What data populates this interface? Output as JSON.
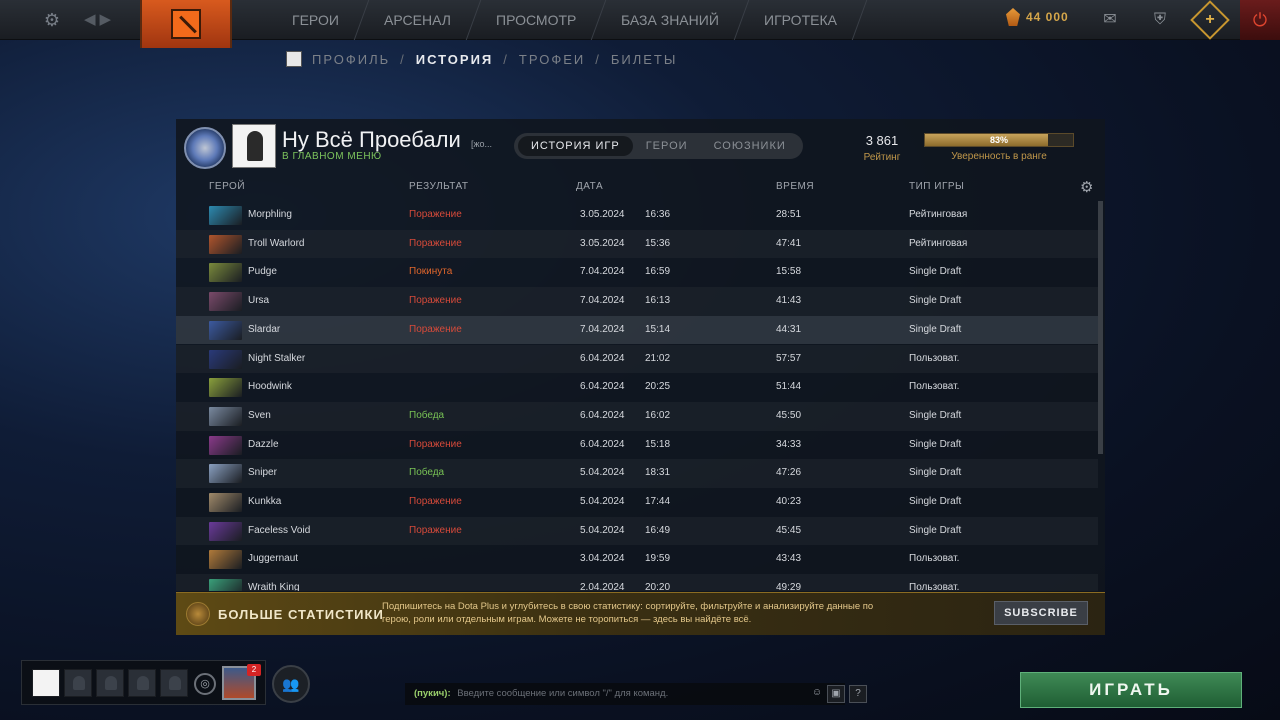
{
  "topbar": {
    "menu": [
      "ГЕРОИ",
      "АРСЕНАЛ",
      "ПРОСМОТР",
      "БАЗА ЗНАНИЙ",
      "ИГРОТЕКА"
    ],
    "currency": "44 000"
  },
  "breadcrumb": {
    "items": [
      "ПРОФИЛЬ",
      "ИСТОРИЯ",
      "ТРОФЕИ",
      "БИЛЕТЫ"
    ],
    "separator": "/",
    "active": "ИСТОРИЯ"
  },
  "profile": {
    "name": "Ну Всё Проебали",
    "tag": "[жо...",
    "status": "В ГЛАВНОМ МЕНЮ",
    "tabs": [
      "ИСТОРИЯ ИГР",
      "ГЕРОИ",
      "СОЮЗНИКИ"
    ],
    "rating_value": "3 861",
    "rating_label": "Рейтинг",
    "confidence_value": "83%",
    "confidence_fraction": 0.83,
    "confidence_label": "Уверенность в ранге"
  },
  "table": {
    "headers": {
      "hero": "ГЕРОЙ",
      "result": "РЕЗУЛЬТАТ",
      "date": "ДАТА",
      "duration": "ВРЕМЯ",
      "mode": "ТИП ИГРЫ"
    },
    "rows": [
      {
        "hero": "Morphling",
        "result": "Поражение",
        "result_type": "loss",
        "date": "3.05.2024",
        "time": "16:36",
        "duration": "28:51",
        "mode": "Рейтинговая",
        "color": "#2d8ab0"
      },
      {
        "hero": "Troll Warlord",
        "result": "Поражение",
        "result_type": "loss",
        "date": "3.05.2024",
        "time": "15:36",
        "duration": "47:41",
        "mode": "Рейтинговая",
        "color": "#b0552d"
      },
      {
        "hero": "Pudge",
        "result": "Покинута",
        "result_type": "left",
        "date": "7.04.2024",
        "time": "16:59",
        "duration": "15:58",
        "mode": "Single Draft",
        "color": "#7a8a3c"
      },
      {
        "hero": "Ursa",
        "result": "Поражение",
        "result_type": "loss",
        "date": "7.04.2024",
        "time": "16:13",
        "duration": "41:43",
        "mode": "Single Draft",
        "color": "#7a4a6a"
      },
      {
        "hero": "Slardar",
        "result": "Поражение",
        "result_type": "loss",
        "date": "7.04.2024",
        "time": "15:14",
        "duration": "44:31",
        "mode": "Single Draft",
        "color": "#3c5aa0"
      },
      {
        "hero": "Night Stalker",
        "result": "",
        "result_type": "none",
        "date": "6.04.2024",
        "time": "21:02",
        "duration": "57:57",
        "mode": "Пользоват.",
        "color": "#2a3a7a"
      },
      {
        "hero": "Hoodwink",
        "result": "",
        "result_type": "none",
        "date": "6.04.2024",
        "time": "20:25",
        "duration": "51:44",
        "mode": "Пользоват.",
        "color": "#8aa03c"
      },
      {
        "hero": "Sven",
        "result": "Победа",
        "result_type": "win",
        "date": "6.04.2024",
        "time": "16:02",
        "duration": "45:50",
        "mode": "Single Draft",
        "color": "#7a8aa0"
      },
      {
        "hero": "Dazzle",
        "result": "Поражение",
        "result_type": "loss",
        "date": "6.04.2024",
        "time": "15:18",
        "duration": "34:33",
        "mode": "Single Draft",
        "color": "#8a3a8a"
      },
      {
        "hero": "Sniper",
        "result": "Победа",
        "result_type": "win",
        "date": "5.04.2024",
        "time": "18:31",
        "duration": "47:26",
        "mode": "Single Draft",
        "color": "#8aa0c0"
      },
      {
        "hero": "Kunkka",
        "result": "Поражение",
        "result_type": "loss",
        "date": "5.04.2024",
        "time": "17:44",
        "duration": "40:23",
        "mode": "Single Draft",
        "color": "#a08a6a"
      },
      {
        "hero": "Faceless Void",
        "result": "Поражение",
        "result_type": "loss",
        "date": "5.04.2024",
        "time": "16:49",
        "duration": "45:45",
        "mode": "Single Draft",
        "color": "#6a3a9a"
      },
      {
        "hero": "Juggernaut",
        "result": "",
        "result_type": "none",
        "date": "3.04.2024",
        "time": "19:59",
        "duration": "43:43",
        "mode": "Пользоват.",
        "color": "#b07a3a"
      },
      {
        "hero": "Wraith King",
        "result": "",
        "result_type": "none",
        "date": "2.04.2024",
        "time": "20:20",
        "duration": "49:29",
        "mode": "Пользоват.",
        "color": "#3aa07a"
      }
    ]
  },
  "plus_banner": {
    "title": "БОЛЬШЕ СТАТИСТИКИ",
    "description": "Подпишитесь на Dota Plus и углубитесь в свою статистику: сортируйте, фильтруйте и анализируйте данные по герою, роли или отдельным играм. Можете не торопиться — здесь вы найдёте всё.",
    "button": "SUBSCRIBE"
  },
  "bottom": {
    "party_badge": "2",
    "chat_channel": "(пукич):",
    "chat_placeholder": "Введите сообщение или символ \"/\" для команд.",
    "play_button": "ИГРАТЬ"
  }
}
